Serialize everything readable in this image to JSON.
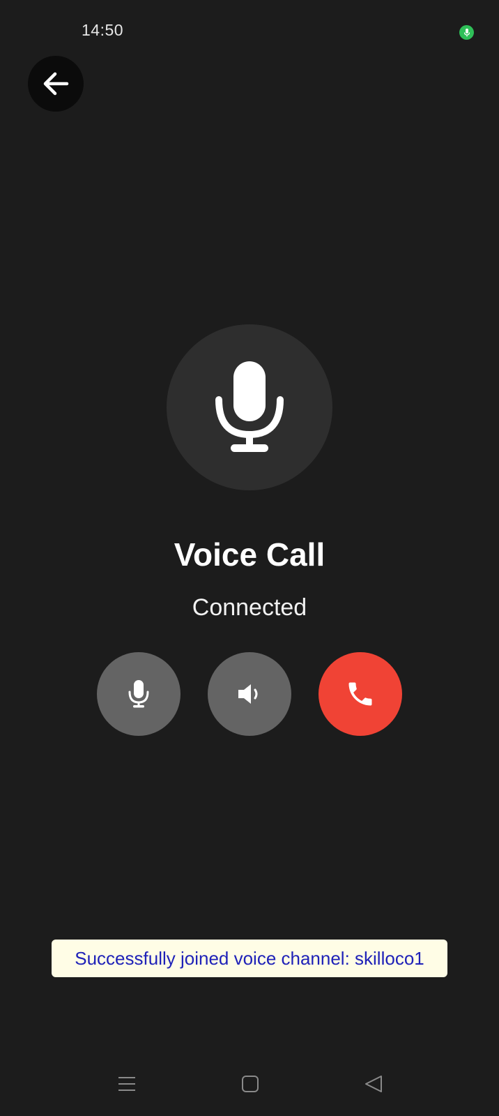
{
  "status_bar": {
    "time": "14:50",
    "mic_indicator_color": "#2fbf58"
  },
  "header": {
    "back_icon": "arrow-left-icon"
  },
  "call": {
    "avatar_icon": "microphone-icon",
    "title": "Voice Call",
    "status": "Connected"
  },
  "controls": {
    "mute_icon": "microphone-icon",
    "speaker_icon": "speaker-icon",
    "end_icon": "phone-icon",
    "end_color": "#f04335",
    "button_color": "#646464"
  },
  "toast": {
    "message": "Successfully joined voice channel: skilloco1"
  },
  "nav_bar": {
    "items": [
      "menu-icon",
      "home-icon",
      "back-icon"
    ]
  }
}
